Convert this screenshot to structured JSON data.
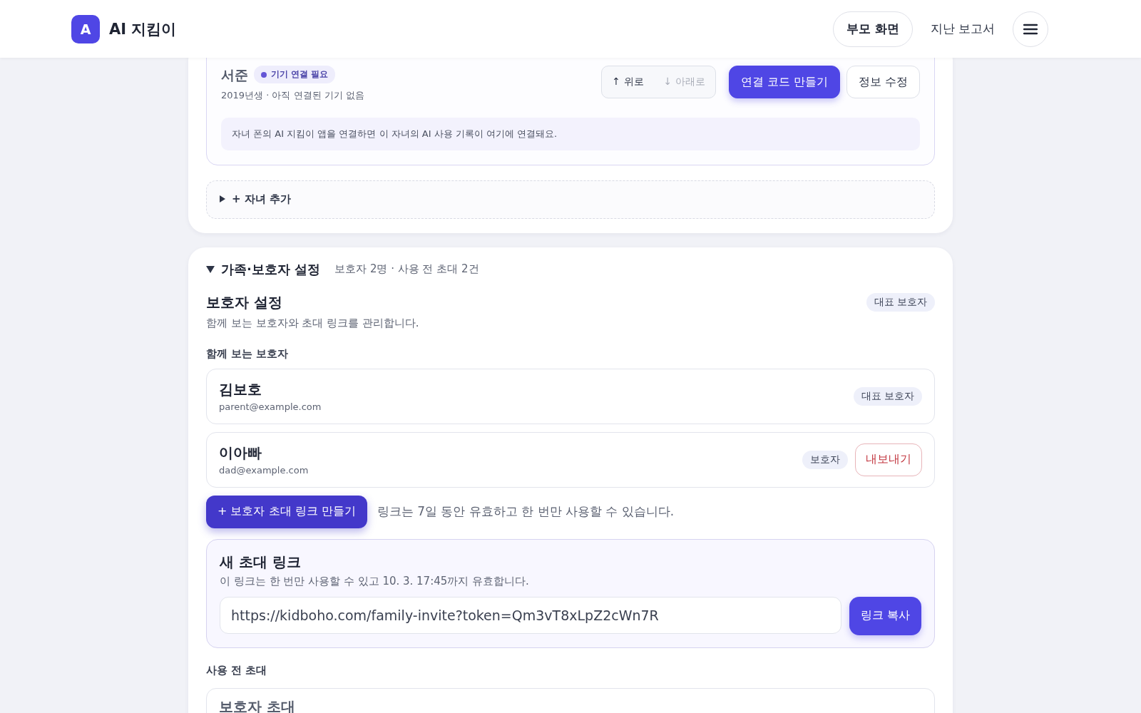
{
  "header": {
    "logo_letter": "A",
    "title": "AI 지킴이",
    "nav": [
      {
        "label": "부모 화면",
        "selected": true
      },
      {
        "label": "지난 보고서",
        "selected": false
      }
    ]
  },
  "children_panel": {
    "child": {
      "name": "서준",
      "status": "기기 연결 필요",
      "subtitle": "2019년생 · 아직 연결된 기기 없음",
      "move_buttons": [
        {
          "label": "↑ 위로",
          "disabled": false
        },
        {
          "label": "↓ 아래로",
          "disabled": true
        }
      ],
      "actions": [
        {
          "label": "연결 코드 만들기",
          "kind": "primary"
        },
        {
          "label": "정보 수정",
          "kind": "secondary"
        }
      ],
      "info": "자녀 폰의 AI 지킴이 앱을 연결하면 이 자녀의 AI 사용 기록이 여기에 연결돼요."
    },
    "add_child": {
      "label": "+ 자녀 추가",
      "expanded": false
    }
  },
  "family_panel": {
    "expanded": true,
    "title": "가족·보호자 설정",
    "summary": "보호자 2명 · 사용 전 초대 2건",
    "heading": "보호자 설정",
    "role_badge": "대표 보호자",
    "description": "함께 보는 보호자와 초대 링크를 관리합니다.",
    "guardians_label": "함께 보는 보호자",
    "guardians": [
      {
        "name": "김보호",
        "email": "parent@example.com",
        "role": "대표 보호자"
      },
      {
        "name": "이아빠",
        "email": "dad@example.com",
        "role": "보호자",
        "remove_label": "내보내기"
      }
    ],
    "create_invite_button": "+ 보호자 초대 링크 만들기",
    "invite_note": "링크는 7일 동안 유효하고 한 번만 사용할 수 있습니다.",
    "new_invite": {
      "title": "새 초대 링크",
      "note": "이 링크는 한 번만 사용할 수 있고 10. 3. 17:45까지 유효합니다.",
      "url": "https://kidboho.com/family-invite?token=Qm3vT8xLpZ2cWn7R",
      "copy_button": "링크 복사"
    },
    "pending_label": "사용 전 초대",
    "pending_invites": [
      {
        "title": "보호자 초대"
      }
    ]
  }
}
